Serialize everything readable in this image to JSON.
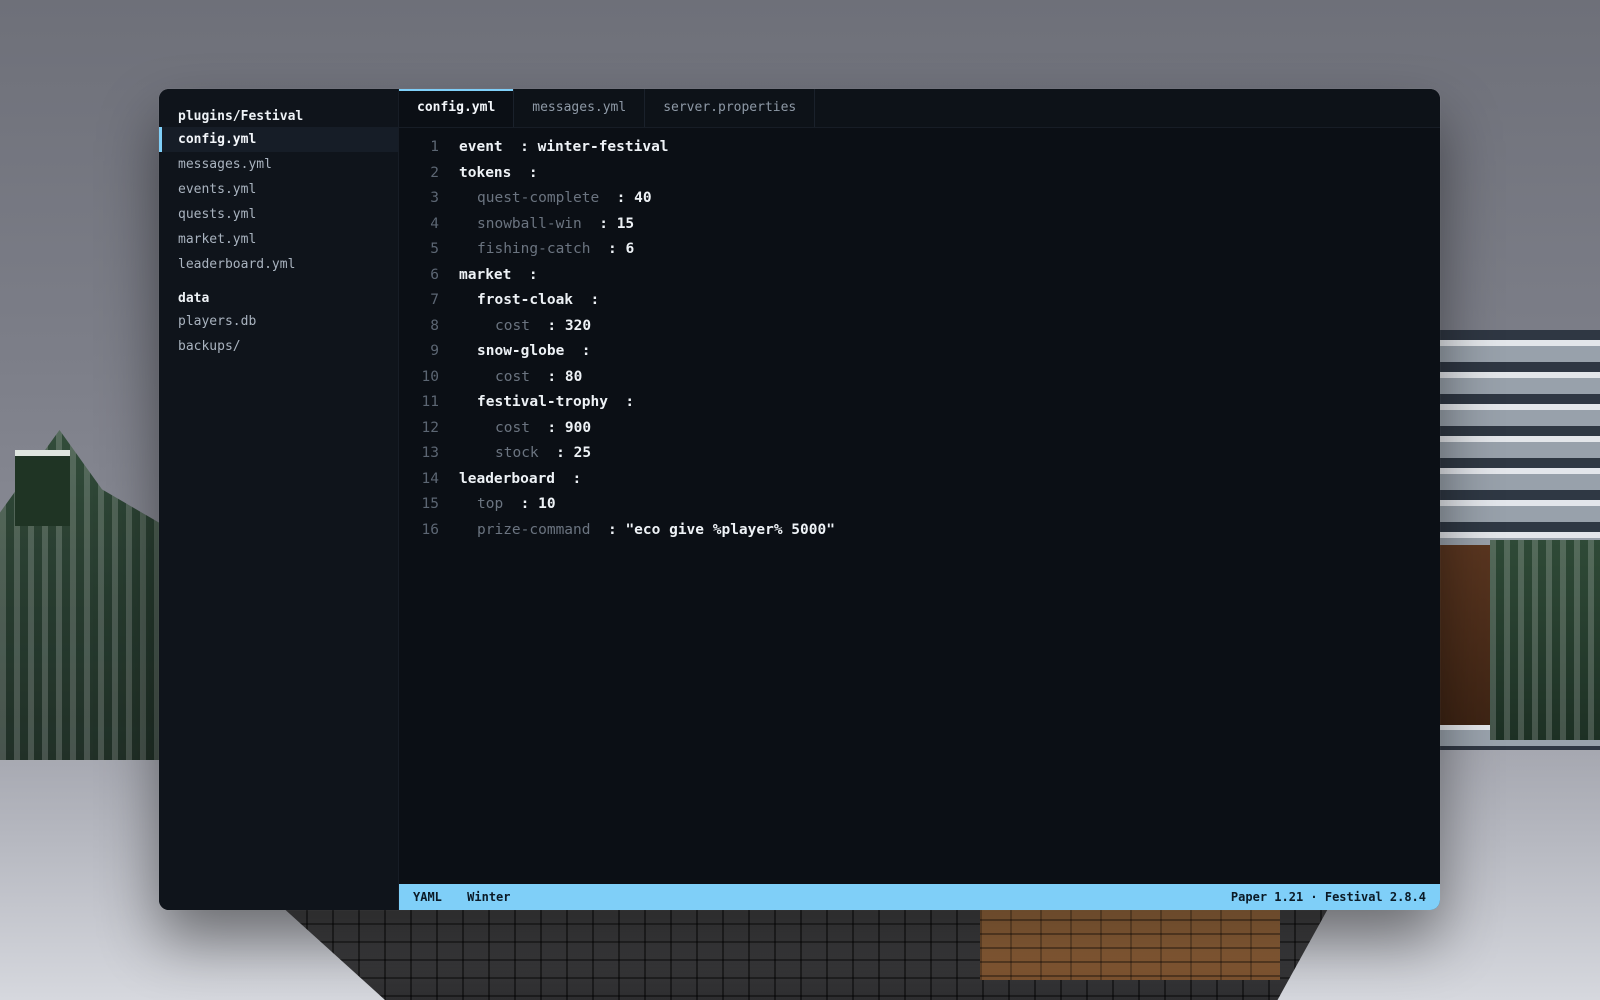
{
  "sidebar": {
    "groups": [
      {
        "heading": "plugins/Festival",
        "items": [
          "config.yml",
          "messages.yml",
          "events.yml",
          "quests.yml",
          "market.yml",
          "leaderboard.yml"
        ]
      },
      {
        "heading": "data",
        "items": [
          "players.db",
          "backups/"
        ]
      }
    ],
    "active_item": "config.yml"
  },
  "tabs": [
    "config.yml",
    "messages.yml",
    "server.properties"
  ],
  "active_tab": "config.yml",
  "editor": {
    "lines": [
      {
        "num": "1",
        "indent": 0,
        "key": "event",
        "value": "winter-festival"
      },
      {
        "num": "2",
        "indent": 0,
        "key": "tokens",
        "value": ""
      },
      {
        "num": "3",
        "indent": 1,
        "key": "quest-complete",
        "value": "40"
      },
      {
        "num": "4",
        "indent": 1,
        "key": "snowball-win",
        "value": "15"
      },
      {
        "num": "5",
        "indent": 1,
        "key": "fishing-catch",
        "value": "6"
      },
      {
        "num": "6",
        "indent": 0,
        "key": "market",
        "value": ""
      },
      {
        "num": "7",
        "indent": 1,
        "key": "frost-cloak",
        "value": "",
        "section": true
      },
      {
        "num": "8",
        "indent": 2,
        "key": "cost",
        "value": "320"
      },
      {
        "num": "9",
        "indent": 1,
        "key": "snow-globe",
        "value": "",
        "section": true
      },
      {
        "num": "10",
        "indent": 2,
        "key": "cost",
        "value": "80"
      },
      {
        "num": "11",
        "indent": 1,
        "key": "festival-trophy",
        "value": "",
        "section": true
      },
      {
        "num": "12",
        "indent": 2,
        "key": "cost",
        "value": "900"
      },
      {
        "num": "13",
        "indent": 2,
        "key": "stock",
        "value": "25"
      },
      {
        "num": "14",
        "indent": 0,
        "key": "leaderboard",
        "value": ""
      },
      {
        "num": "15",
        "indent": 1,
        "key": "top",
        "value": "10"
      },
      {
        "num": "16",
        "indent": 1,
        "key": "prize-command",
        "value": "\"eco give %player% 5000\""
      }
    ]
  },
  "statusbar": {
    "language": "YAML",
    "theme": "Winter",
    "right": "Paper 1.21 · Festival 2.8.4"
  },
  "colors": {
    "accent": "#7fcff8",
    "editor_bg": "#0b0f15",
    "sidebar_bg": "#0f141b"
  }
}
